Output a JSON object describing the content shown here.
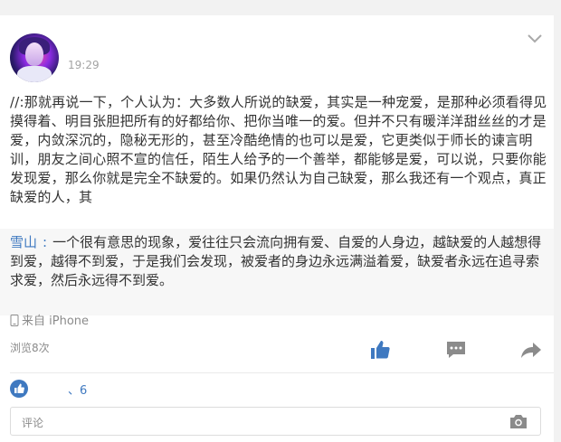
{
  "post": {
    "timestamp": "19:29",
    "content": "//:那就再说一下，个人认为：大多数人所说的缺爱，其实是一种宠爱，是那种必须看得见摸得着、明目张胆把所有的好都给你、把你当唯一的爱。但并不只有暖洋洋甜丝丝的才是爱，内敛深沉的，隐秘无形的，甚至冷酷绝情的也可以是爱，它更类似于师长的谏言明训，朋友之间心照不宣的信任，陌生人给予的一个善举，都能够是爱，可以说，只要你能发现爱，那么你就是完全不缺爱的。如果仍然认为自己缺爱，那么我还有一个观点，真正缺爱的人，其"
  },
  "quote": {
    "user": "雪山",
    "separator": ":",
    "text": "一个很有意思的现象，爱往往只会流向拥有爱、自爱的人身边，越缺爱的人越想得到爱，越得不到爱，于是我们会发现，被爱者的身边永远满溢着爱，缺爱者永远在追寻索求爱，然后永远得不到爱。"
  },
  "source": {
    "label": "来自 iPhone"
  },
  "stats": {
    "views": "浏览8次"
  },
  "likes": {
    "text": "、6"
  },
  "comment": {
    "placeholder": "评论"
  },
  "icons": {
    "chevron": "chevron-down-icon",
    "phone": "phone-icon",
    "like": "thumbs-up-icon",
    "comment": "comment-icon",
    "share": "share-icon",
    "camera": "camera-icon"
  },
  "colors": {
    "accent": "#3f79c0",
    "muted": "#8b8b8b",
    "quote_bg": "#f7f7f7"
  }
}
